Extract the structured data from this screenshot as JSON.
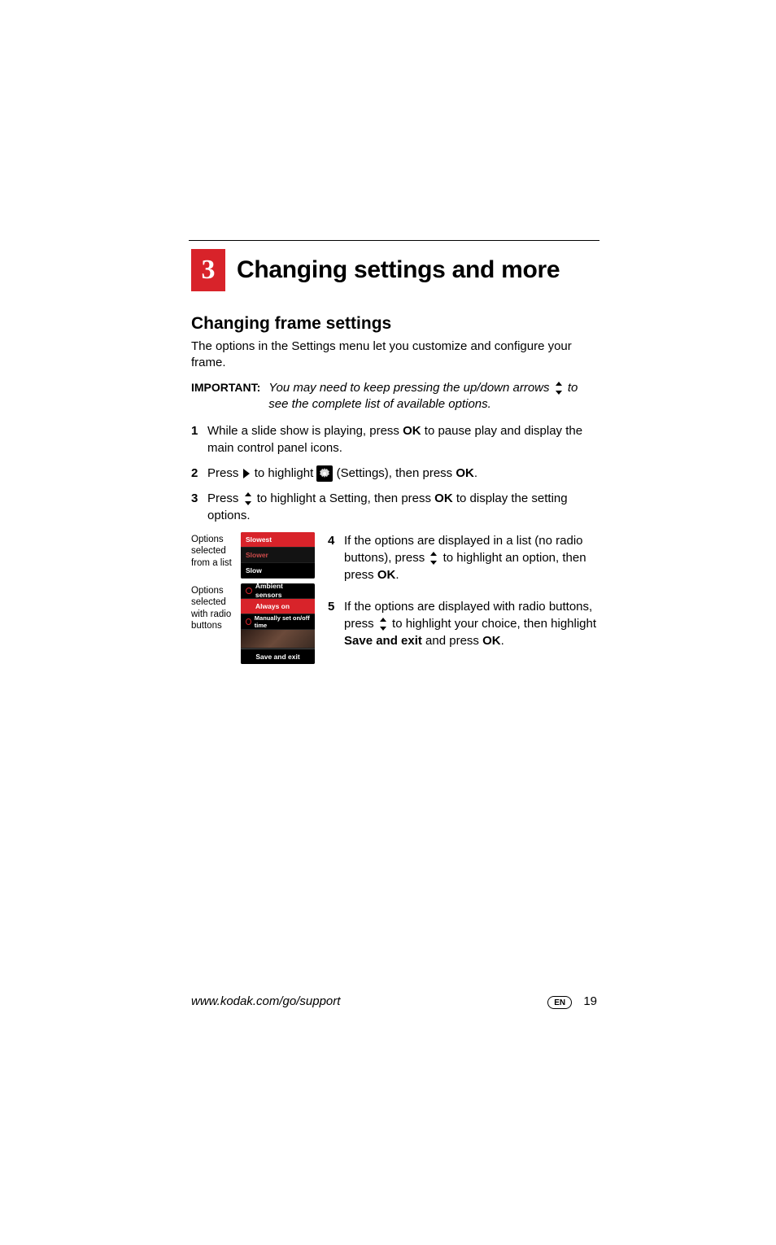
{
  "chapter": {
    "number": "3",
    "title": "Changing settings and more"
  },
  "section": {
    "title": "Changing frame settings",
    "intro": "The options in the Settings menu let you customize and configure your frame."
  },
  "important": {
    "label": "IMPORTANT:",
    "text_before": "You may need to keep pressing the up/down arrows ",
    "text_after": " to see the complete list of available options."
  },
  "steps": {
    "s1_a": "While a slide show is playing, press ",
    "s1_ok": "OK",
    "s1_b": " to pause play and display the main control panel icons.",
    "s2_a": "Press ",
    "s2_b": " to highlight ",
    "s2_c": " (Settings), then press ",
    "s2_ok": "OK",
    "s2_d": ".",
    "s3_a": "Press ",
    "s3_b": " to highlight a Setting, then press ",
    "s3_ok": "OK",
    "s3_c": " to display the setting options.",
    "s4_a": "If the options are displayed in a list (no radio buttons), press ",
    "s4_b": " to highlight an option, then press ",
    "s4_ok": "OK",
    "s4_c": ".",
    "s5_a": "If the options are displayed with radio buttons, press ",
    "s5_b": " to highlight your choice, then highlight ",
    "s5_save": "Save and exit",
    "s5_c": " and press ",
    "s5_ok": "OK",
    "s5_d": "."
  },
  "figure": {
    "cap1": "Options selected from a list",
    "cap2": "Options selected with radio buttons",
    "list1": {
      "item1": "Slowest",
      "item2": "Slower",
      "item3": "Slow"
    },
    "list2": {
      "item1": "Ambient sensors",
      "item2": "Always on",
      "item3": "Manually set on/off time",
      "save": "Save and exit"
    },
    "step4_num": "4",
    "step5_num": "5"
  },
  "footer": {
    "url": "www.kodak.com/go/support",
    "lang": "EN",
    "page": "19"
  }
}
